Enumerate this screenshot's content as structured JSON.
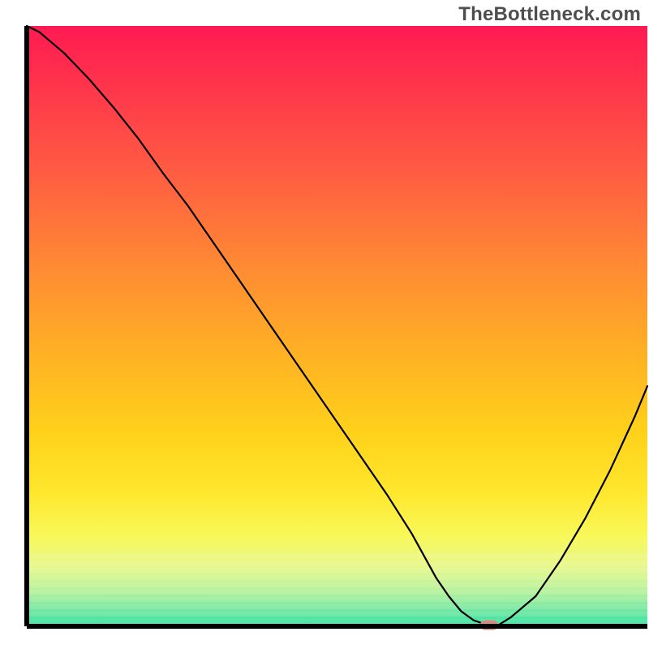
{
  "watermark": "TheBottleneck.com",
  "chart_data": {
    "type": "line",
    "title": "",
    "xlabel": "",
    "ylabel": "",
    "xlim": [
      0,
      100
    ],
    "ylim": [
      0,
      100
    ],
    "x": [
      0,
      2,
      6,
      10,
      14,
      18,
      22,
      26,
      30,
      34,
      38,
      42,
      46,
      50,
      54,
      58,
      62,
      66,
      68,
      70,
      72,
      74,
      76,
      78,
      82,
      86,
      90,
      94,
      98,
      100
    ],
    "values": [
      100,
      99.0,
      95.5,
      91.2,
      86.4,
      81.2,
      75.4,
      70.0,
      64.0,
      58.0,
      52.0,
      46.0,
      40.0,
      34.0,
      28.0,
      22.0,
      15.5,
      8.0,
      5.0,
      2.5,
      1.0,
      0.3,
      0.2,
      1.5,
      5.0,
      11.0,
      18.0,
      26.0,
      35.0,
      40.0
    ],
    "marker": {
      "x": 74.5,
      "y": 0.2
    },
    "gradient_stops": [
      {
        "offset": 0,
        "color": "#ff1a52"
      },
      {
        "offset": 12,
        "color": "#ff3a4a"
      },
      {
        "offset": 25,
        "color": "#ff5e42"
      },
      {
        "offset": 40,
        "color": "#ff8a33"
      },
      {
        "offset": 55,
        "color": "#ffb224"
      },
      {
        "offset": 68,
        "color": "#ffd21a"
      },
      {
        "offset": 78,
        "color": "#ffe82e"
      },
      {
        "offset": 85,
        "color": "#f8f85a"
      },
      {
        "offset": 90,
        "color": "#e8f88a"
      },
      {
        "offset": 94,
        "color": "#b8f29c"
      },
      {
        "offset": 97,
        "color": "#7ae8a2"
      },
      {
        "offset": 100,
        "color": "#2fe29f"
      }
    ],
    "marker_color": "#d98880",
    "axis_color": "#000000"
  }
}
